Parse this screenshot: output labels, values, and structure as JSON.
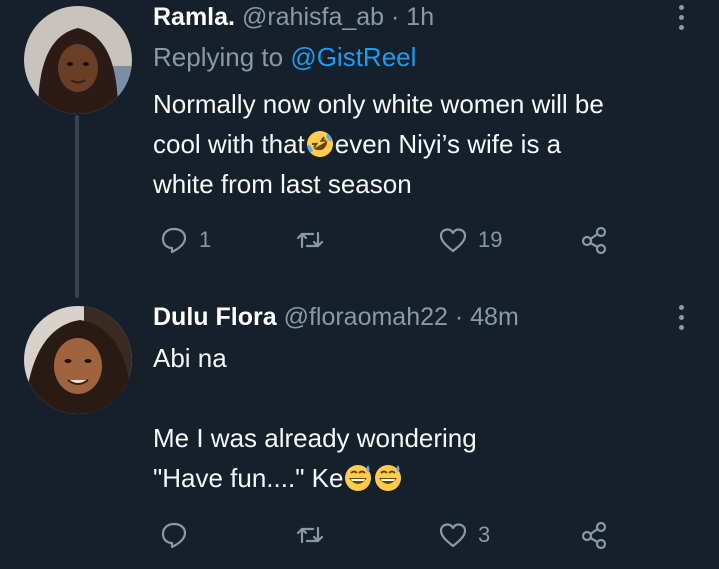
{
  "tweets": [
    {
      "display_name": "Ramla.",
      "handle": "@rahisfa_ab",
      "sep": " · ",
      "time": "1h",
      "replying_prefix": "Replying to ",
      "replying_to": "@GistReel",
      "text_1": "Normally now only white women will be",
      "text_2a": "cool with that",
      "text_2b": "even Niyi’s wife is a",
      "text_3": "white from last season",
      "emoji_1": "rofl-emoji",
      "replies": "1",
      "retweets": "",
      "likes": "19"
    },
    {
      "display_name": "Dulu Flora",
      "handle": "@floraomah22",
      "sep": " · ",
      "time": "48m",
      "line_1": "Abi na",
      "line_2": "Me I was already wondering",
      "line_3": "\"Have fun....\" Ke",
      "emoji_1": "grinning-sweat-emoji",
      "replies": "",
      "retweets": "",
      "likes": "3"
    }
  ],
  "icons": {
    "reply": "reply-icon",
    "retweet": "retweet-icon",
    "like": "heart-icon",
    "share": "share-icon",
    "more": "more-icon"
  },
  "colors": {
    "background": "#15202b",
    "secondary_text": "#8b98a5",
    "link": "#1d9bf0",
    "thread_line": "#38444d"
  }
}
